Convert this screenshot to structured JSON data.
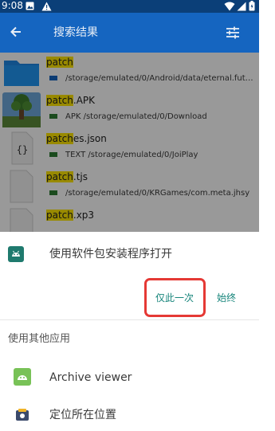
{
  "status_bar": {
    "time": "9:08"
  },
  "app_bar": {
    "title": "搜索结果"
  },
  "results": [
    {
      "match": "patch",
      "rest": "",
      "path": "/storage/emulated/0/Android/data/eternal.fut…",
      "kind": "folder",
      "tag_color": "#1565c0"
    },
    {
      "match": "patch",
      "rest": ".APK",
      "path": "APK /storage/emulated/0/Download",
      "kind": "apk",
      "tag_color": "#2e7d32"
    },
    {
      "match": "patch",
      "rest": "es.json",
      "path": "TEXT /storage/emulated/0/JoiPlay",
      "kind": "json",
      "tag_color": "#2e7d32"
    },
    {
      "match": "patch",
      "rest": ".tjs",
      "path": "/storage/emulated/0/KRGames/com.meta.jhsy",
      "kind": "file",
      "tag_color": "#2e7d32"
    },
    {
      "match": "patch",
      "rest": ".xp3",
      "path": "",
      "kind": "file",
      "tag_color": "#2e7d32"
    }
  ],
  "sheet": {
    "title": "使用软件包安装程序打开",
    "just_once": "仅此一次",
    "always": "始终",
    "other_apps_label": "使用其他应用",
    "apps": [
      {
        "label": "Archive viewer",
        "icon": "android-icon"
      },
      {
        "label": "定位所在位置",
        "icon": "locate-icon"
      }
    ]
  },
  "colors": {
    "accent": "#17857b",
    "highlight": "#ffe600",
    "app_bar": "#1565c0",
    "status_bar": "#0b3f78",
    "annotation": "#e53935"
  }
}
